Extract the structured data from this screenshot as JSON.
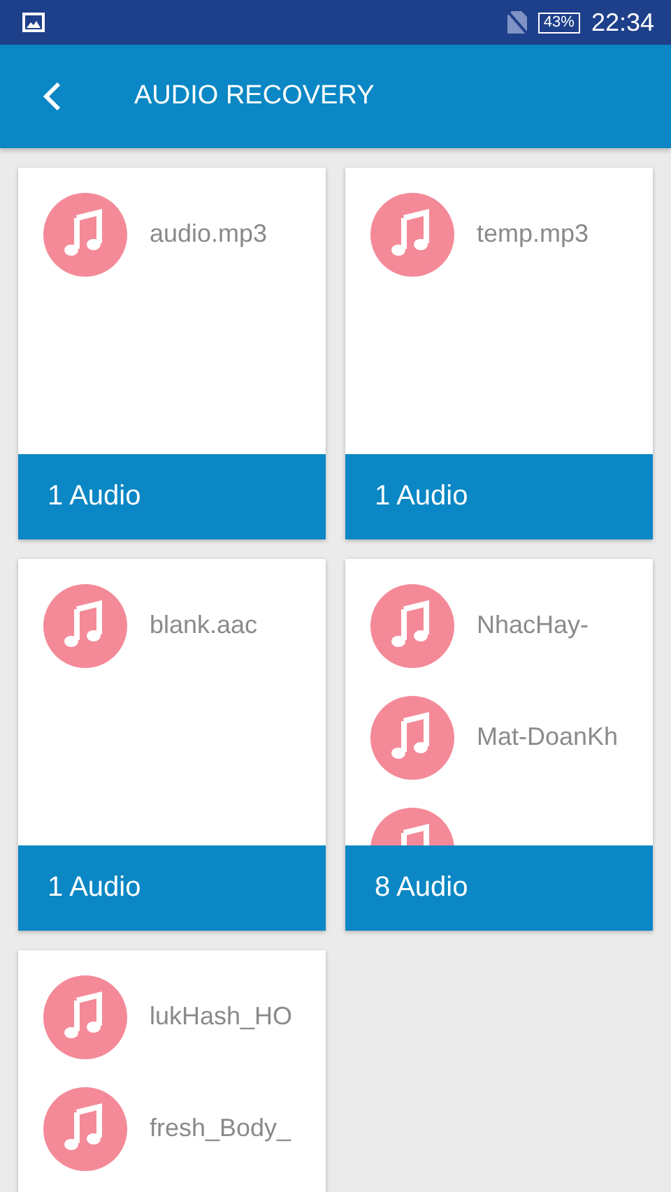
{
  "status_bar": {
    "battery": "43%",
    "time": "22:34"
  },
  "header": {
    "title": "AUDIO RECOVERY"
  },
  "folders": [
    {
      "files": [
        {
          "kind": "audio",
          "name": "audio.mp3"
        }
      ],
      "count": "1 Audio"
    },
    {
      "files": [
        {
          "kind": "audio",
          "name": "temp.mp3"
        }
      ],
      "count": "1 Audio"
    },
    {
      "files": [
        {
          "kind": "audio",
          "name": "blank.aac"
        }
      ],
      "count": "1 Audio"
    },
    {
      "files": [
        {
          "kind": "audio",
          "name": "NhacHay-"
        },
        {
          "kind": "audio",
          "name": "Mat-DoanKh"
        },
        {
          "kind": "audio"
        }
      ],
      "count": "8 Audio"
    },
    {
      "files": [
        {
          "kind": "audio",
          "name": "lukHash_HO"
        },
        {
          "kind": "audio",
          "name": "fresh_Body_"
        }
      ]
    }
  ]
}
